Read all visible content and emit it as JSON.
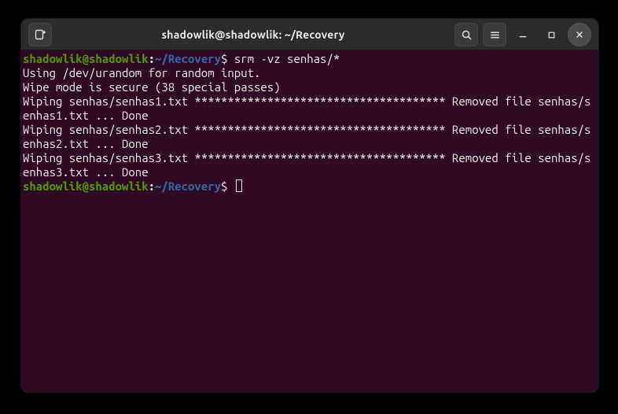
{
  "window": {
    "title": "shadowlik@shadowlik: ~/Recovery"
  },
  "prompt": {
    "user_host": "shadowlik@shadowlik",
    "colon": ":",
    "path": "~/Recovery",
    "dollar": "$"
  },
  "command": "srm -vz senhas/*",
  "output": [
    "Using /dev/urandom for random input.",
    "Wipe mode is secure (38 special passes)",
    "Wiping senhas/senhas1.txt ************************************** Removed file senhas/senhas1.txt ... Done",
    "Wiping senhas/senhas2.txt ************************************** Removed file senhas/senhas2.txt ... Done",
    "Wiping senhas/senhas3.txt ************************************** Removed file senhas/senhas3.txt ... Done"
  ],
  "icons": {
    "new_tab": "new-tab-icon",
    "search": "search-icon",
    "menu": "hamburger-menu-icon",
    "minimize": "minimize-icon",
    "maximize": "maximize-icon",
    "close": "close-icon"
  }
}
